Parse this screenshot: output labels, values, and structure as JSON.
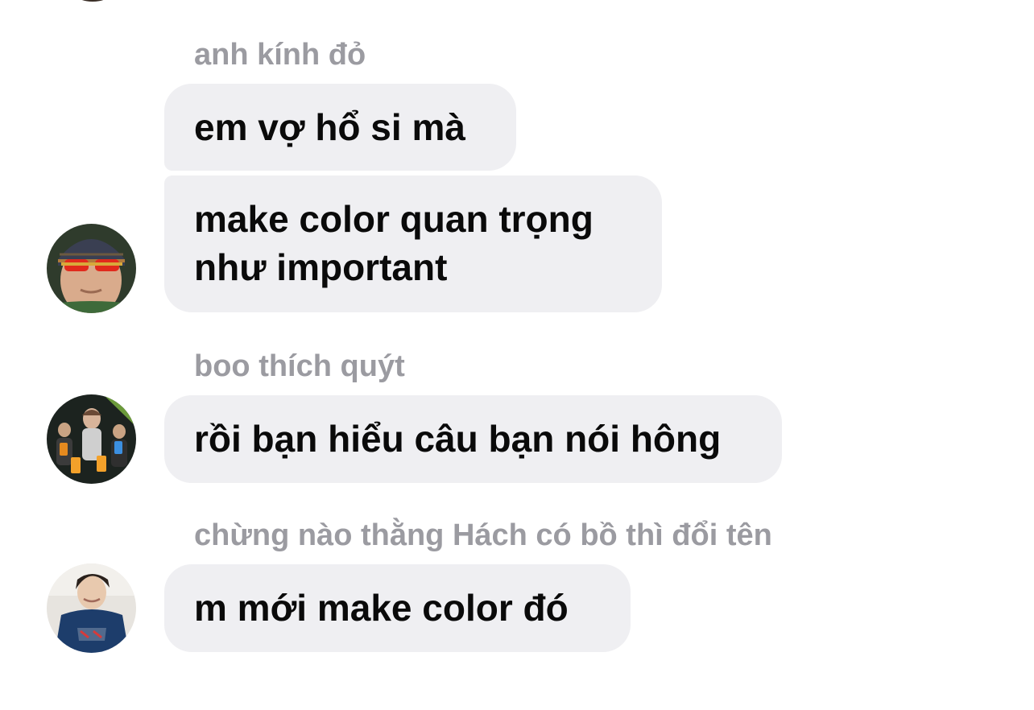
{
  "messages": [
    {
      "sender": "anh kính đỏ",
      "bubbles": [
        {
          "lines": [
            "em vợ hổ si mà"
          ]
        },
        {
          "lines": [
            "make color quan trọng",
            "như important"
          ]
        }
      ],
      "avatar": "avatar-red-glasses-beanie"
    },
    {
      "sender": "boo thích quýt",
      "bubbles": [
        {
          "lines": [
            "rồi bạn hiểu câu bạn nói hông"
          ]
        }
      ],
      "avatar": "avatar-group-photo"
    },
    {
      "sender": "chừng nào thằng Hách có bồ thì đổi tên",
      "bubbles": [
        {
          "lines": [
            "m mới make color đó"
          ]
        }
      ],
      "avatar": "avatar-blue-hoodie"
    }
  ]
}
